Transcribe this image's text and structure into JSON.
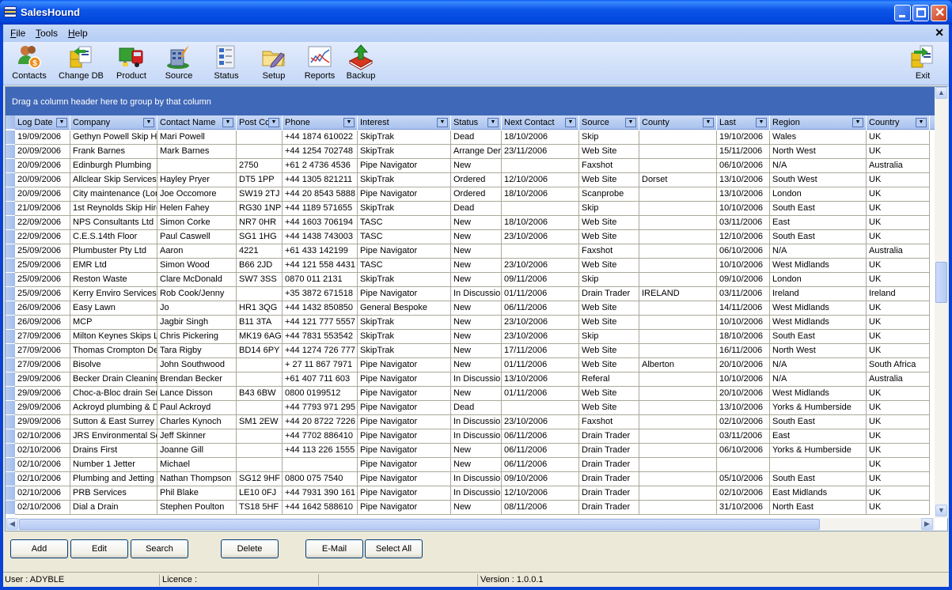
{
  "window": {
    "title": "SalesHound",
    "controls": {
      "minimize": "_",
      "maximize": "□",
      "close": "✕"
    }
  },
  "menu": {
    "items": [
      {
        "label": "File",
        "accel": "F",
        "rest": "ile"
      },
      {
        "label": "Tools",
        "accel": "T",
        "rest": "ools"
      },
      {
        "label": "Help",
        "accel": "H",
        "rest": "elp"
      }
    ],
    "mdi_close": "✕"
  },
  "toolbar": {
    "items": [
      {
        "label": "Contacts",
        "icon": "contacts-icon"
      },
      {
        "label": "Change DB",
        "icon": "change-db-icon"
      },
      {
        "label": "Product",
        "icon": "product-truck-icon"
      },
      {
        "label": "Source",
        "icon": "source-building-icon"
      },
      {
        "label": "Status",
        "icon": "status-list-icon"
      },
      {
        "label": "Setup",
        "icon": "setup-folder-icon"
      },
      {
        "label": "Reports",
        "icon": "reports-chart-icon"
      },
      {
        "label": "Backup",
        "icon": "backup-book-icon"
      }
    ],
    "exit": {
      "label": "Exit",
      "icon": "exit-icon"
    }
  },
  "grid": {
    "group_hint": "Drag a column header here to group by that column",
    "columns": [
      "Log Date",
      "Company",
      "Contact Name",
      "Post Co",
      "Phone",
      "Interest",
      "Status",
      "Next Contact",
      "Source",
      "County",
      "Last",
      "Region",
      "Country"
    ],
    "rows": [
      [
        "19/09/2006",
        "Gethyn Powell Skip Hi",
        "Mari Powell",
        "",
        "+44 1874 610022",
        "SkipTrak",
        "Dead",
        "18/10/2006",
        "Skip",
        "",
        "19/10/2006",
        "Wales",
        "UK"
      ],
      [
        "20/09/2006",
        "Frank Barnes",
        "Mark Barnes",
        "",
        "+44 1254 702748",
        "SkipTrak",
        "Arrange Der",
        "23/11/2006",
        "Web Site",
        "",
        "15/11/2006",
        "North West",
        "UK"
      ],
      [
        "20/09/2006",
        "Edinburgh Plumbing",
        "",
        "2750",
        "+61 2 4736 4536",
        "Pipe Navigator",
        "New",
        "",
        "Faxshot",
        "",
        "06/10/2006",
        "N/A",
        "Australia"
      ],
      [
        "20/09/2006",
        "Allclear Skip Services",
        "Hayley Pryer",
        "DT5 1PP",
        "+44 1305 821211",
        "SkipTrak",
        "Ordered",
        "12/10/2006",
        "Web Site",
        "Dorset",
        "13/10/2006",
        "South West",
        "UK"
      ],
      [
        "20/09/2006",
        "City maintenance (Lon",
        "Joe Occomore",
        "SW19 2TJ",
        "+44 20 8543 5888",
        "Pipe Navigator",
        "Ordered",
        "18/10/2006",
        "Scanprobe",
        "",
        "13/10/2006",
        "London",
        "UK"
      ],
      [
        "21/09/2006",
        "1st Reynolds Skip Hire",
        "Helen Fahey",
        "RG30 1NP",
        "+44 1189 571655",
        "SkipTrak",
        "Dead",
        "",
        "Skip",
        "",
        "10/10/2006",
        "South East",
        "UK"
      ],
      [
        "22/09/2006",
        "NPS Consultants Ltd",
        "Simon Corke",
        "NR7 0HR",
        "+44 1603 706194",
        "TASC",
        "New",
        "18/10/2006",
        "Web Site",
        "",
        "03/11/2006",
        "East",
        "UK"
      ],
      [
        "22/09/2006",
        "C.E.S.14th Floor",
        "Paul Caswell",
        "SG1 1HG",
        "+44 1438 743003",
        "TASC",
        "New",
        "23/10/2006",
        "Web Site",
        "",
        "12/10/2006",
        "South East",
        "UK"
      ],
      [
        "25/09/2006",
        "Plumbuster Pty Ltd",
        "Aaron",
        "4221",
        "+61 433 142199",
        "Pipe Navigator",
        "New",
        "",
        "Faxshot",
        "",
        "06/10/2006",
        "N/A",
        "Australia"
      ],
      [
        "25/09/2006",
        "EMR Ltd",
        "Simon Wood",
        "B66 2JD",
        "+44 121 558 4431",
        "TASC",
        "New",
        "23/10/2006",
        "Web Site",
        "",
        "10/10/2006",
        "West Midlands",
        "UK"
      ],
      [
        "25/09/2006",
        "Reston Waste",
        "Clare McDonald",
        "SW7 3SS",
        "0870 011 2131",
        "SkipTrak",
        "New",
        "09/11/2006",
        "Skip",
        "",
        "09/10/2006",
        "London",
        "UK"
      ],
      [
        "25/09/2006",
        "Kerry Enviro Services",
        "Rob Cook/Jenny",
        "",
        "+35 3872 671518",
        "Pipe Navigator",
        "In Discussio",
        "01/11/2006",
        "Drain Trader",
        "IRELAND",
        "03/11/2006",
        "Ireland",
        "Ireland"
      ],
      [
        "26/09/2006",
        "Easy Lawn",
        "Jo",
        "HR1 3QG",
        "+44 1432 850850",
        "General Bespoke",
        "New",
        "06/11/2006",
        "Web Site",
        "",
        "14/11/2006",
        "West Midlands",
        "UK"
      ],
      [
        "26/09/2006",
        "MCP",
        "Jagbir Singh",
        "B11 3TA",
        "+44 121 777 5557",
        "SkipTrak",
        "New",
        "23/10/2006",
        "Web Site",
        "",
        "10/10/2006",
        "West Midlands",
        "UK"
      ],
      [
        "27/09/2006",
        "Milton Keynes Skips L",
        "Chris Pickering",
        "MK19 6AG",
        "+44 7831 553542",
        "SkipTrak",
        "New",
        "23/10/2006",
        "Skip",
        "",
        "18/10/2006",
        "South East",
        "UK"
      ],
      [
        "27/09/2006",
        "Thomas Crompton De",
        "Tara Rigby",
        "BD14 6PY",
        "+44 1274 726 777",
        "SkipTrak",
        "New",
        "17/11/2006",
        "Web Site",
        "",
        "16/11/2006",
        "North West",
        "UK"
      ],
      [
        "27/09/2006",
        "Bisolve",
        "John Southwood",
        "",
        "+ 27 11 867 7971",
        "Pipe Navigator",
        "New",
        "01/11/2006",
        "Web Site",
        "Alberton",
        "20/10/2006",
        "N/A",
        "South Africa"
      ],
      [
        "29/09/2006",
        "Becker Drain Cleaning",
        "Brendan Becker",
        "",
        "+61 407 711 603",
        "Pipe Navigator",
        "In Discussio",
        "13/10/2006",
        "Referal",
        "",
        "10/10/2006",
        "N/A",
        "Australia"
      ],
      [
        "29/09/2006",
        "Choc-a-Bloc drain Ser",
        "Lance Disson",
        "B43 6BW",
        "0800 0199512",
        "Pipe Navigator",
        "New",
        "01/11/2006",
        "Web Site",
        "",
        "20/10/2006",
        "West Midlands",
        "UK"
      ],
      [
        "29/09/2006",
        "Ackroyd plumbing & D",
        "Paul Ackroyd",
        "",
        "+44 7793 971 295",
        "Pipe Navigator",
        "Dead",
        "",
        "Web Site",
        "",
        "13/10/2006",
        "Yorks & Humberside",
        "UK"
      ],
      [
        "29/09/2006",
        "Sutton & East Surrey V",
        "Charles Kynoch",
        "SM1 2EW",
        "+44 20 8722 7226",
        "Pipe Navigator",
        "In Discussio",
        "23/10/2006",
        "Faxshot",
        "",
        "02/10/2006",
        "South East",
        "UK"
      ],
      [
        "02/10/2006",
        "JRS Environmental Se",
        "Jeff Skinner",
        "",
        "+44 7702 886410",
        "Pipe Navigator",
        "In Discussio",
        "06/11/2006",
        "Drain Trader",
        "",
        "03/11/2006",
        "East",
        "UK"
      ],
      [
        "02/10/2006",
        "Drains First",
        "Joanne Gill",
        "",
        "+44 113 226 1555",
        "Pipe Navigator",
        "New",
        "06/11/2006",
        "Drain Trader",
        "",
        "06/10/2006",
        "Yorks & Humberside",
        "UK"
      ],
      [
        "02/10/2006",
        "Number 1 Jetter",
        "Michael",
        "",
        "",
        "Pipe Navigator",
        "New",
        "06/11/2006",
        "Drain Trader",
        "",
        "",
        "",
        "UK"
      ],
      [
        "02/10/2006",
        "Plumbing and Jetting L",
        "Nathan Thompson",
        "SG12 9HF",
        "0800 075 7540",
        "Pipe Navigator",
        "In Discussio",
        "09/10/2006",
        "Drain Trader",
        "",
        "05/10/2006",
        "South East",
        "UK"
      ],
      [
        "02/10/2006",
        "PRB Services",
        "Phil Blake",
        "LE10 0FJ",
        "+44 7931 390 161",
        "Pipe Navigator",
        "In Discussio",
        "12/10/2006",
        "Drain Trader",
        "",
        "02/10/2006",
        "East Midlands",
        "UK"
      ],
      [
        "02/10/2006",
        "Dial a Drain",
        "Stephen Poulton",
        "TS18 5HF",
        "+44 1642 588610",
        "Pipe Navigator",
        "New",
        "08/11/2006",
        "Drain Trader",
        "",
        "31/10/2006",
        "North East",
        "UK"
      ]
    ],
    "scroll": {
      "up": "▲",
      "down": "▼",
      "left": "◀",
      "right": "▶",
      "dropdown": "▼"
    }
  },
  "buttons": [
    {
      "label": "Add",
      "name": "add-button"
    },
    {
      "label": "Edit",
      "name": "edit-button"
    },
    {
      "label": "Search",
      "name": "search-button"
    },
    {
      "label": "Delete",
      "name": "delete-button"
    },
    {
      "label": "E-Mail",
      "name": "email-button"
    },
    {
      "label": "Select All",
      "name": "select-all-button"
    }
  ],
  "status": {
    "user": "User : ADYBLE",
    "licence": "Licence :",
    "version": "Version : 1.0.0.1"
  }
}
